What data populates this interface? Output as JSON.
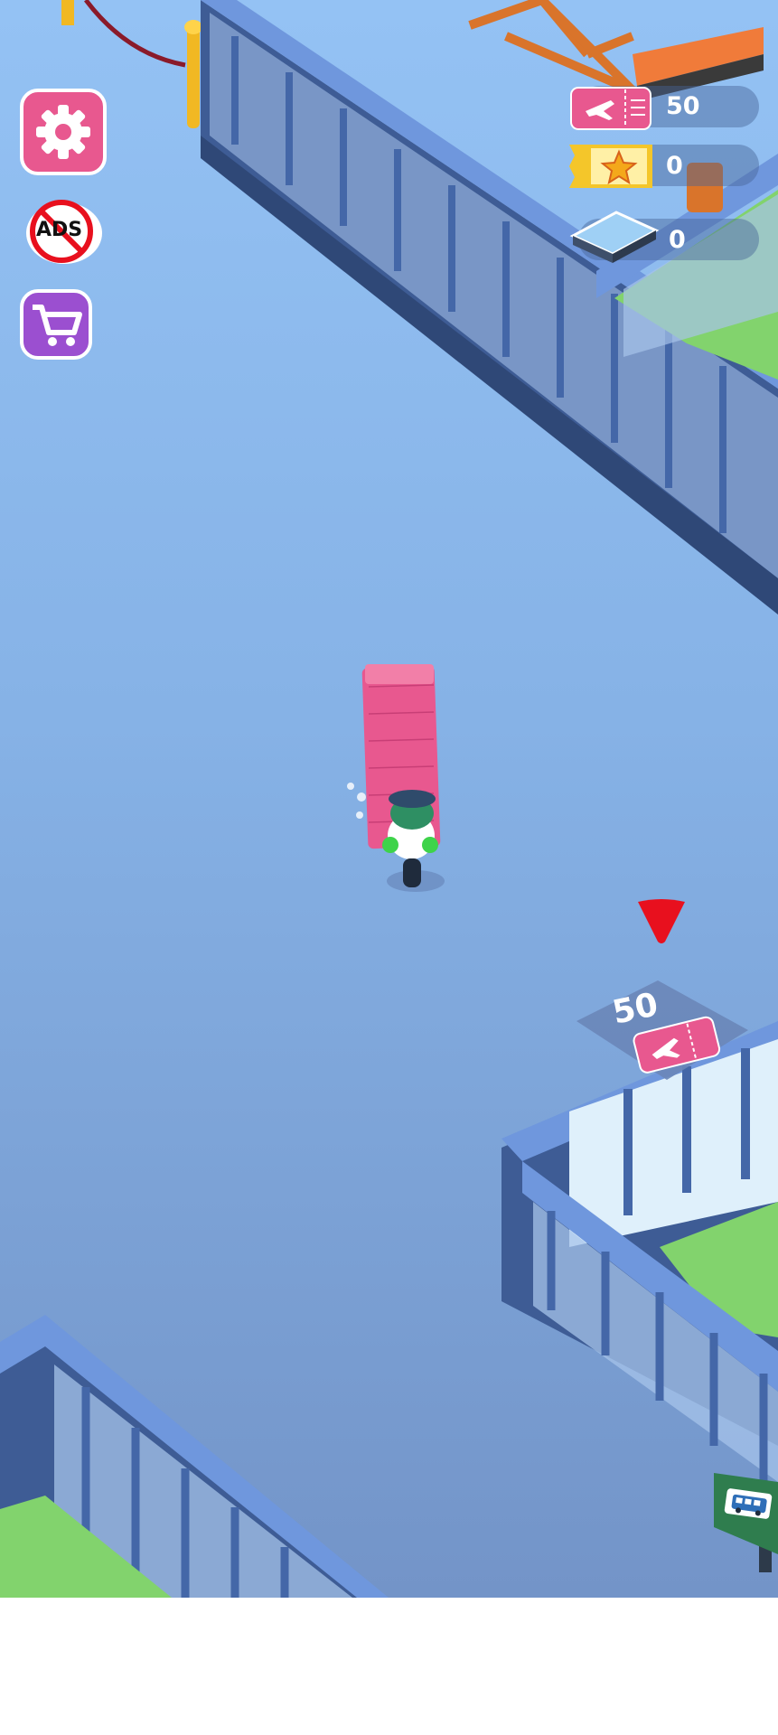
{
  "hud": {
    "tickets": {
      "icon": "plane-ticket-icon",
      "value": "50"
    },
    "vip_tickets": {
      "icon": "star-ticket-icon",
      "value": "0"
    },
    "tiles": {
      "icon": "floor-tile-icon",
      "value": "0"
    }
  },
  "buttons": {
    "settings": {
      "icon": "gear-icon"
    },
    "no_ads": {
      "icon": "no-ads-icon",
      "label": "ADS"
    },
    "shop": {
      "icon": "shopping-cart-icon"
    }
  },
  "unlock_pad": {
    "price": "50",
    "icon": "plane-ticket-icon"
  },
  "objective_marker": {
    "icon": "red-arrow-down-icon"
  },
  "bus_sign": {
    "icon": "bus-icon"
  },
  "colors": {
    "accent_pink": "#e8588f",
    "ticket_gold": "#f4c62a",
    "shop_purple": "#9b4fd0",
    "marker_red": "#e8101e",
    "floor_blue": "#8bb6ea",
    "grass_green": "#82d36d"
  }
}
